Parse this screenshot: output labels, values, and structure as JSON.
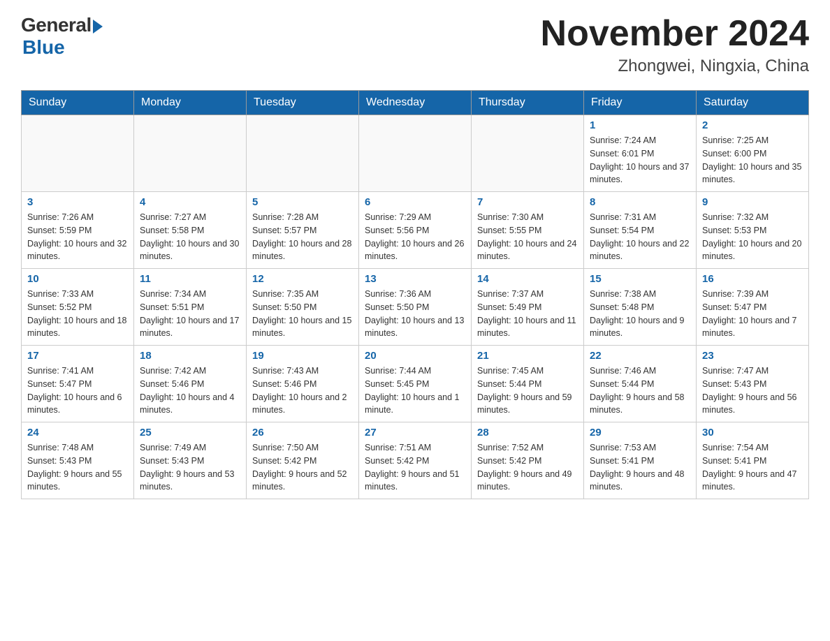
{
  "header": {
    "logo_general": "General",
    "logo_blue": "Blue",
    "title": "November 2024",
    "subtitle": "Zhongwei, Ningxia, China"
  },
  "days_of_week": [
    "Sunday",
    "Monday",
    "Tuesday",
    "Wednesday",
    "Thursday",
    "Friday",
    "Saturday"
  ],
  "weeks": [
    [
      {
        "day": "",
        "info": ""
      },
      {
        "day": "",
        "info": ""
      },
      {
        "day": "",
        "info": ""
      },
      {
        "day": "",
        "info": ""
      },
      {
        "day": "",
        "info": ""
      },
      {
        "day": "1",
        "info": "Sunrise: 7:24 AM\nSunset: 6:01 PM\nDaylight: 10 hours and 37 minutes."
      },
      {
        "day": "2",
        "info": "Sunrise: 7:25 AM\nSunset: 6:00 PM\nDaylight: 10 hours and 35 minutes."
      }
    ],
    [
      {
        "day": "3",
        "info": "Sunrise: 7:26 AM\nSunset: 5:59 PM\nDaylight: 10 hours and 32 minutes."
      },
      {
        "day": "4",
        "info": "Sunrise: 7:27 AM\nSunset: 5:58 PM\nDaylight: 10 hours and 30 minutes."
      },
      {
        "day": "5",
        "info": "Sunrise: 7:28 AM\nSunset: 5:57 PM\nDaylight: 10 hours and 28 minutes."
      },
      {
        "day": "6",
        "info": "Sunrise: 7:29 AM\nSunset: 5:56 PM\nDaylight: 10 hours and 26 minutes."
      },
      {
        "day": "7",
        "info": "Sunrise: 7:30 AM\nSunset: 5:55 PM\nDaylight: 10 hours and 24 minutes."
      },
      {
        "day": "8",
        "info": "Sunrise: 7:31 AM\nSunset: 5:54 PM\nDaylight: 10 hours and 22 minutes."
      },
      {
        "day": "9",
        "info": "Sunrise: 7:32 AM\nSunset: 5:53 PM\nDaylight: 10 hours and 20 minutes."
      }
    ],
    [
      {
        "day": "10",
        "info": "Sunrise: 7:33 AM\nSunset: 5:52 PM\nDaylight: 10 hours and 18 minutes."
      },
      {
        "day": "11",
        "info": "Sunrise: 7:34 AM\nSunset: 5:51 PM\nDaylight: 10 hours and 17 minutes."
      },
      {
        "day": "12",
        "info": "Sunrise: 7:35 AM\nSunset: 5:50 PM\nDaylight: 10 hours and 15 minutes."
      },
      {
        "day": "13",
        "info": "Sunrise: 7:36 AM\nSunset: 5:50 PM\nDaylight: 10 hours and 13 minutes."
      },
      {
        "day": "14",
        "info": "Sunrise: 7:37 AM\nSunset: 5:49 PM\nDaylight: 10 hours and 11 minutes."
      },
      {
        "day": "15",
        "info": "Sunrise: 7:38 AM\nSunset: 5:48 PM\nDaylight: 10 hours and 9 minutes."
      },
      {
        "day": "16",
        "info": "Sunrise: 7:39 AM\nSunset: 5:47 PM\nDaylight: 10 hours and 7 minutes."
      }
    ],
    [
      {
        "day": "17",
        "info": "Sunrise: 7:41 AM\nSunset: 5:47 PM\nDaylight: 10 hours and 6 minutes."
      },
      {
        "day": "18",
        "info": "Sunrise: 7:42 AM\nSunset: 5:46 PM\nDaylight: 10 hours and 4 minutes."
      },
      {
        "day": "19",
        "info": "Sunrise: 7:43 AM\nSunset: 5:46 PM\nDaylight: 10 hours and 2 minutes."
      },
      {
        "day": "20",
        "info": "Sunrise: 7:44 AM\nSunset: 5:45 PM\nDaylight: 10 hours and 1 minute."
      },
      {
        "day": "21",
        "info": "Sunrise: 7:45 AM\nSunset: 5:44 PM\nDaylight: 9 hours and 59 minutes."
      },
      {
        "day": "22",
        "info": "Sunrise: 7:46 AM\nSunset: 5:44 PM\nDaylight: 9 hours and 58 minutes."
      },
      {
        "day": "23",
        "info": "Sunrise: 7:47 AM\nSunset: 5:43 PM\nDaylight: 9 hours and 56 minutes."
      }
    ],
    [
      {
        "day": "24",
        "info": "Sunrise: 7:48 AM\nSunset: 5:43 PM\nDaylight: 9 hours and 55 minutes."
      },
      {
        "day": "25",
        "info": "Sunrise: 7:49 AM\nSunset: 5:43 PM\nDaylight: 9 hours and 53 minutes."
      },
      {
        "day": "26",
        "info": "Sunrise: 7:50 AM\nSunset: 5:42 PM\nDaylight: 9 hours and 52 minutes."
      },
      {
        "day": "27",
        "info": "Sunrise: 7:51 AM\nSunset: 5:42 PM\nDaylight: 9 hours and 51 minutes."
      },
      {
        "day": "28",
        "info": "Sunrise: 7:52 AM\nSunset: 5:42 PM\nDaylight: 9 hours and 49 minutes."
      },
      {
        "day": "29",
        "info": "Sunrise: 7:53 AM\nSunset: 5:41 PM\nDaylight: 9 hours and 48 minutes."
      },
      {
        "day": "30",
        "info": "Sunrise: 7:54 AM\nSunset: 5:41 PM\nDaylight: 9 hours and 47 minutes."
      }
    ]
  ]
}
